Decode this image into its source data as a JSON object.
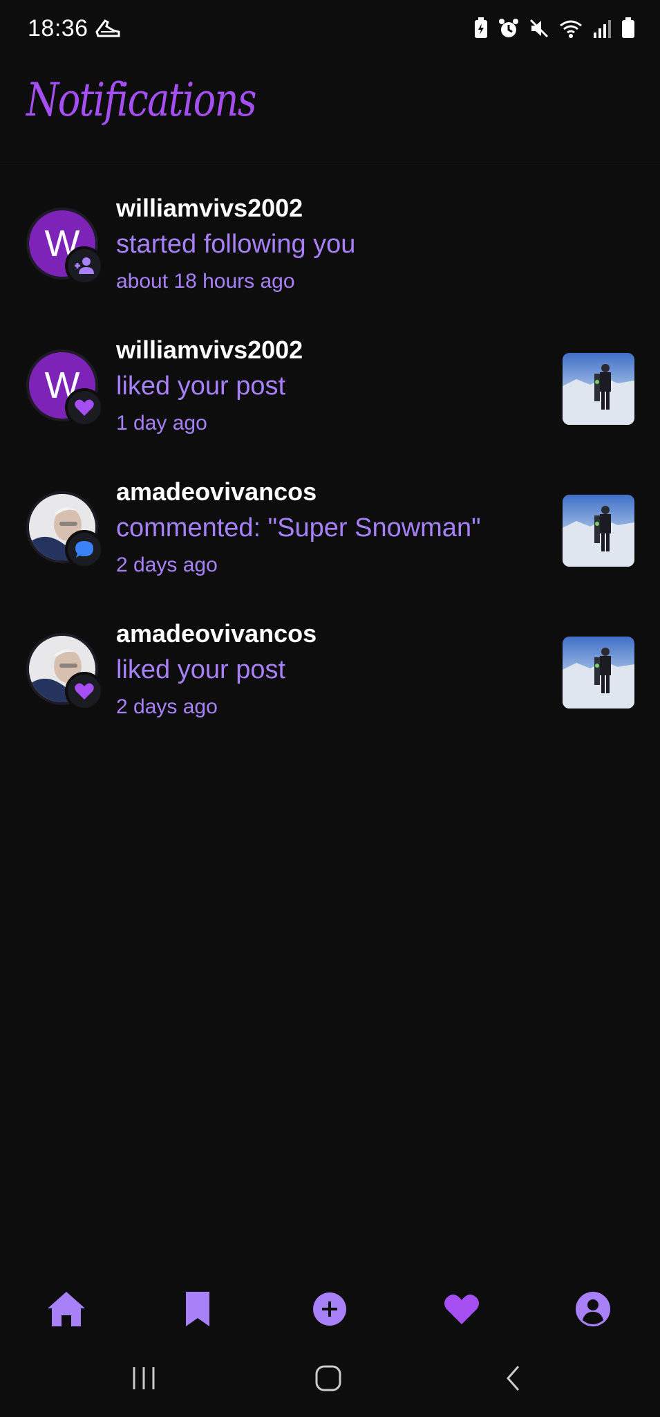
{
  "status_bar": {
    "time": "18:36",
    "icons": [
      "shoe-icon",
      "battery-saver-icon",
      "alarm-icon",
      "mute-icon",
      "wifi-icon",
      "signal-icon",
      "battery-icon"
    ]
  },
  "header": {
    "title": "Notifications"
  },
  "colors": {
    "accent": "#a54ff2",
    "secondary_text": "#a880f7",
    "avatar_letter_bg": "#7d23b8",
    "background": "#0d0d0e",
    "comment_badge": "#3b82f6"
  },
  "notifications": [
    {
      "avatar_initial": "W",
      "avatar_type": "letter",
      "badge_icon": "follow-icon",
      "username": "williamvivs2002",
      "action": "started following you",
      "time": "about 18 hours ago",
      "has_thumbnail": false
    },
    {
      "avatar_initial": "W",
      "avatar_type": "letter",
      "badge_icon": "heart-icon",
      "username": "williamvivs2002",
      "action": "liked your post",
      "time": "1 day ago",
      "has_thumbnail": true
    },
    {
      "avatar_initial": "",
      "avatar_type": "photo",
      "badge_icon": "comment-icon",
      "username": "amadeovivancos",
      "action": "commented: \"Super Snowman\"",
      "time": "2 days ago",
      "has_thumbnail": true
    },
    {
      "avatar_initial": "",
      "avatar_type": "photo",
      "badge_icon": "heart-icon",
      "username": "amadeovivancos",
      "action": "liked your post",
      "time": "2 days ago",
      "has_thumbnail": true
    }
  ],
  "bottom_nav": [
    {
      "icon": "home-icon"
    },
    {
      "icon": "bookmark-icon"
    },
    {
      "icon": "add-icon"
    },
    {
      "icon": "heart-icon",
      "active": true
    },
    {
      "icon": "profile-icon"
    }
  ],
  "system_nav": [
    {
      "icon": "recents-icon"
    },
    {
      "icon": "home-circle-icon"
    },
    {
      "icon": "back-icon"
    }
  ]
}
